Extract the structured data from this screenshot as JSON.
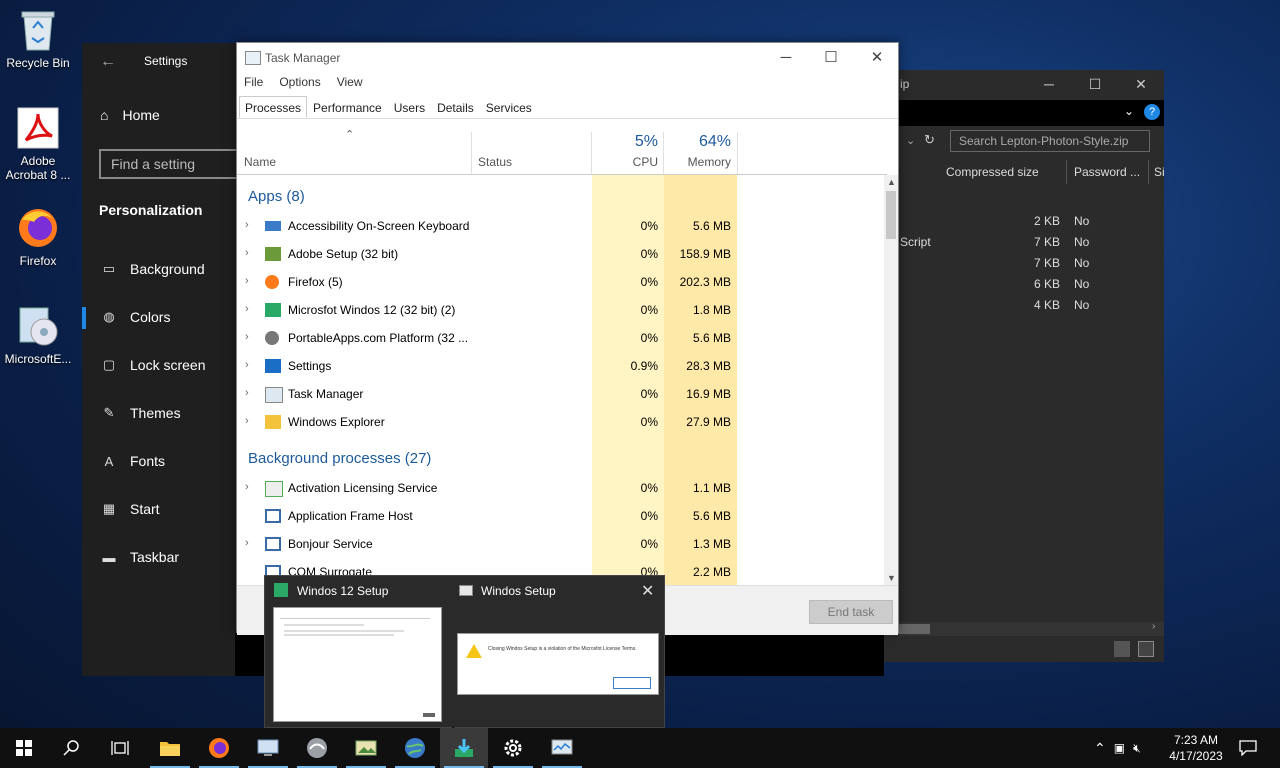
{
  "desktop": {
    "icons": [
      {
        "label": "Recycle Bin"
      },
      {
        "label": "Adobe Acrobat 8 ..."
      },
      {
        "label": "Firefox"
      },
      {
        "label": "MicrosoftE..."
      }
    ]
  },
  "settings": {
    "title": "Settings",
    "home": "Home",
    "search_placeholder": "Find a setting",
    "section": "Personalization",
    "items": [
      {
        "label": "Background",
        "icon": "image-icon"
      },
      {
        "label": "Colors",
        "icon": "palette-icon"
      },
      {
        "label": "Lock screen",
        "icon": "lock-screen-icon"
      },
      {
        "label": "Themes",
        "icon": "themes-icon"
      },
      {
        "label": "Fonts",
        "icon": "fonts-icon"
      },
      {
        "label": "Start",
        "icon": "start-icon"
      },
      {
        "label": "Taskbar",
        "icon": "taskbar-icon"
      }
    ]
  },
  "archive": {
    "title_fragment": "ip",
    "search_placeholder": "Search Lepton-Photon-Style.zip",
    "columns": [
      "Compressed size",
      "Password ...",
      "Si"
    ],
    "rows": [
      {
        "name": "",
        "size": "2 KB",
        "password": "No"
      },
      {
        "name": "Script",
        "size": "7 KB",
        "password": "No"
      },
      {
        "name": "",
        "size": "7 KB",
        "password": "No"
      },
      {
        "name": "",
        "size": "6 KB",
        "password": "No"
      },
      {
        "name": "",
        "size": "4 KB",
        "password": "No"
      }
    ]
  },
  "taskmanager": {
    "title": "Task Manager",
    "menu": [
      "File",
      "Options",
      "View"
    ],
    "tabs": [
      "Processes",
      "Performance",
      "Users",
      "Details",
      "Services"
    ],
    "columns": {
      "name": "Name",
      "status": "Status",
      "cpu_pct": "5%",
      "cpu": "CPU",
      "mem_pct": "64%",
      "mem": "Memory"
    },
    "apps_header": "Apps (8)",
    "apps": [
      {
        "name": "Accessibility On-Screen Keyboard",
        "cpu": "0%",
        "mem": "5.6 MB"
      },
      {
        "name": "Adobe Setup (32 bit)",
        "cpu": "0%",
        "mem": "158.9 MB"
      },
      {
        "name": "Firefox (5)",
        "cpu": "0%",
        "mem": "202.3 MB"
      },
      {
        "name": "Microsfot Windos 12 (32 bit) (2)",
        "cpu": "0%",
        "mem": "1.8 MB"
      },
      {
        "name": "PortableApps.com Platform (32 ...",
        "cpu": "0%",
        "mem": "5.6 MB"
      },
      {
        "name": "Settings",
        "cpu": "0.9%",
        "mem": "28.3 MB"
      },
      {
        "name": "Task Manager",
        "cpu": "0%",
        "mem": "16.9 MB"
      },
      {
        "name": "Windows Explorer",
        "cpu": "0%",
        "mem": "27.9 MB"
      }
    ],
    "bg_header": "Background processes (27)",
    "background": [
      {
        "name": "Activation Licensing Service",
        "cpu": "0%",
        "mem": "1.1 MB"
      },
      {
        "name": "Application Frame Host",
        "cpu": "0%",
        "mem": "5.6 MB"
      },
      {
        "name": "Bonjour Service",
        "cpu": "0%",
        "mem": "1.3 MB"
      },
      {
        "name": "COM Surrogate",
        "cpu": "0%",
        "mem": "2.2 MB"
      }
    ],
    "end_task": "End task"
  },
  "thumbnails": {
    "first_title": "Windos 12 Setup",
    "second_title": "Windos Setup",
    "dialog_text": "Closing Windos Setup is a violation of the Microsfot License Terms.",
    "dialog_ok": "OK"
  },
  "taskbar": {
    "time": "7:23 AM",
    "date": "4/17/2023"
  }
}
